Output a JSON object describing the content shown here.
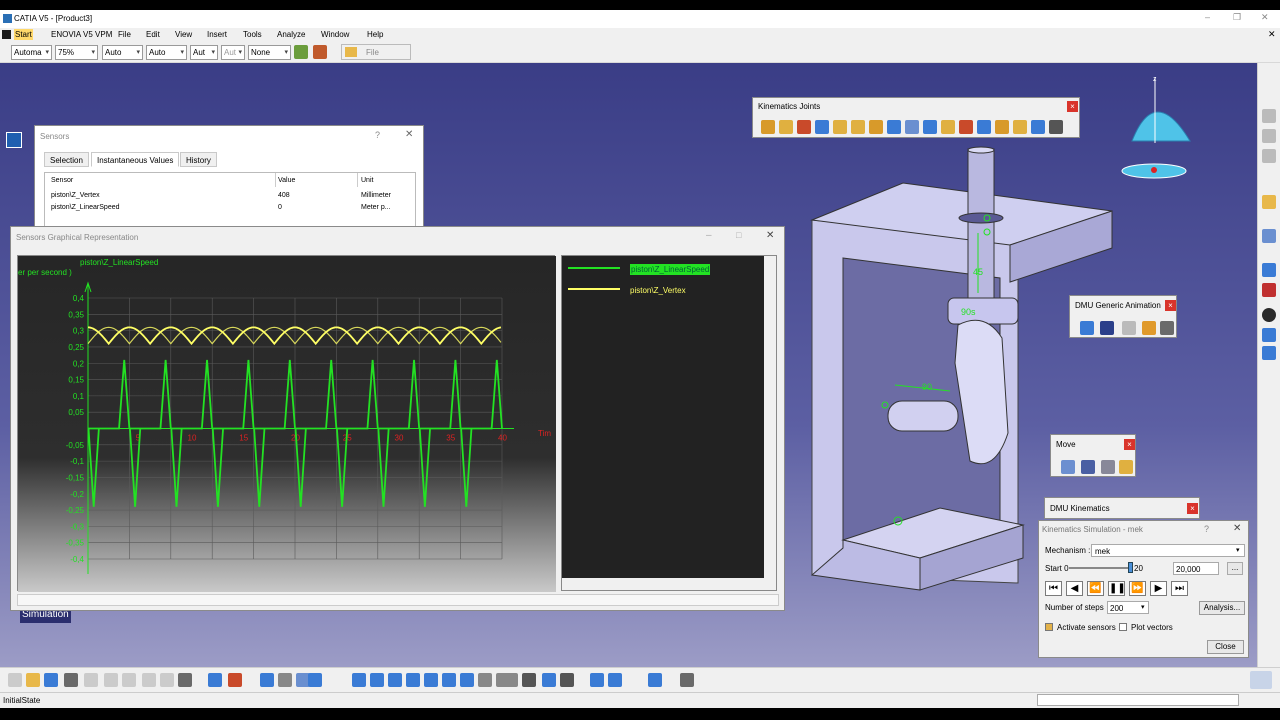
{
  "window": {
    "title": "CATIA V5 - [Product3]"
  },
  "menu": [
    "Start",
    "ENOVIA V5 VPM",
    "File",
    "Edit",
    "View",
    "Insert",
    "Tools",
    "Analyze",
    "Window",
    "Help"
  ],
  "toolbar_combos": [
    "Automa",
    "75%",
    "Auto",
    "Auto",
    "Aut",
    "Aut",
    "None"
  ],
  "file_button": "File",
  "tree_simulation": "Simulation",
  "sensors": {
    "title": "Sensors",
    "tabs": [
      "Selection",
      "Instantaneous Values",
      "History"
    ],
    "columns": [
      "Sensor",
      "Value",
      "Unit"
    ],
    "rows": [
      {
        "sensor": "piston\\Z_Vertex",
        "value": "408",
        "unit": "Millimeter"
      },
      {
        "sensor": "piston\\Z_LinearSpeed",
        "value": "0",
        "unit": "Meter p..."
      }
    ]
  },
  "graph": {
    "title": "Sensors Graphical Representation",
    "series_label": "piston\\Z_LinearSpeed",
    "unit_label": "er per second )",
    "y_ticks": [
      "0,4",
      "0,35",
      "0,3",
      "0,25",
      "0,2",
      "0,15",
      "0,1",
      "0,05",
      "-0,05",
      "-0,1",
      "-0,15",
      "-0,2",
      "-0,25",
      "-0,3",
      "-0,35",
      "-0,4"
    ],
    "x_ticks": [
      "5",
      "10",
      "15",
      "20",
      "25",
      "30",
      "35",
      "40"
    ],
    "legend": [
      "piston\\Z_LinearSpeed",
      "piston\\Z_Vertex"
    ]
  },
  "chart_data": {
    "type": "line",
    "title": "",
    "xlabel": "Tim",
    "ylabel": "er per second )",
    "ylim": [
      -0.4,
      0.4
    ],
    "xlim": [
      0,
      40
    ],
    "series": [
      {
        "name": "piston\\Z_LinearSpeed",
        "color": "#23e223",
        "period": 4,
        "peak_up": 0.21,
        "peak_down": -0.24
      },
      {
        "name": "piston\\Z_Vertex",
        "color": "#ffff66",
        "min": 0.26,
        "max": 0.31,
        "period": 4
      }
    ]
  },
  "kin_joints": {
    "title": "Kinematics Joints"
  },
  "dmu_anim": {
    "title": "DMU Generic Animation"
  },
  "move": {
    "title": "Move"
  },
  "dmu_kin": {
    "title": "DMU Kinematics"
  },
  "sim": {
    "title": "Kinematics Simulation - mek",
    "mechanism_label": "Mechanism :",
    "mechanism_value": "mek",
    "start_label": "Start 0",
    "slider_value": "20",
    "end_value": "20,000",
    "steps_label": "Number of steps",
    "steps_value": "200",
    "analysis": "Analysis...",
    "activate": "Activate sensors",
    "plot": "Plot vectors",
    "close": "Close"
  },
  "status": "InitialState",
  "model": {
    "label1": "45",
    "label2": "90",
    "label3": "90s"
  },
  "colors": {
    "accent_green": "#23e223",
    "yellow": "#ffff66",
    "close_red": "#d9342b"
  }
}
